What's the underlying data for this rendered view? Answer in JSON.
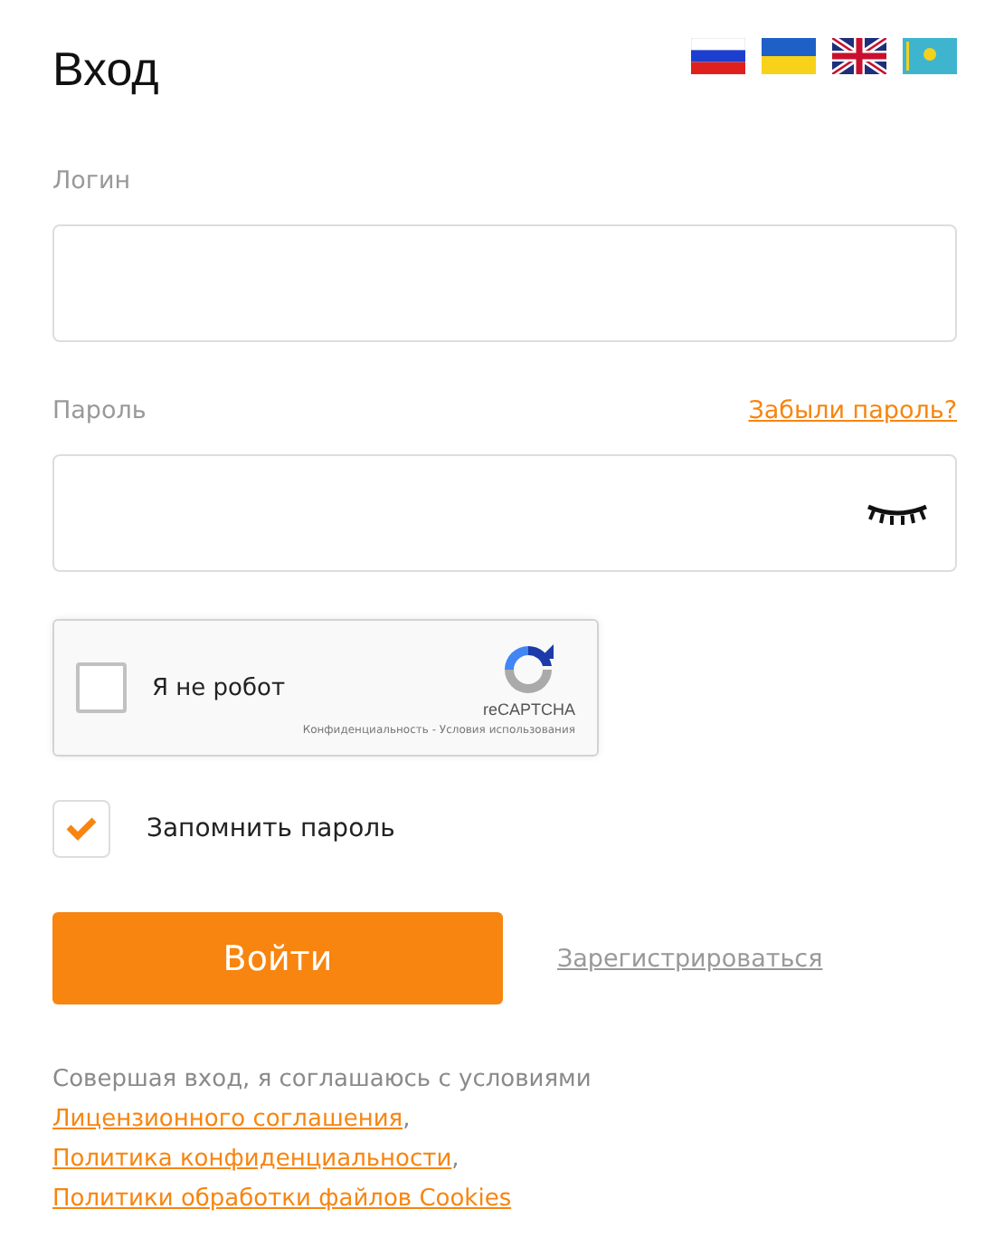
{
  "title": "Вход",
  "login": {
    "label": "Логин"
  },
  "password": {
    "label": "Пароль",
    "forgot_link": "Забыли пароль?"
  },
  "captcha": {
    "label": "Я не робот",
    "checked": false,
    "brand": "reCAPTCHA",
    "footer": "Конфиденциальность - Условия использования"
  },
  "remember": {
    "label": "Запомнить пароль",
    "checked": true
  },
  "submit": "Войти",
  "register_link": "Зарегистрироваться",
  "agreement": {
    "text": "Совершая вход, я соглашаюсь с условиями",
    "links": [
      {
        "text": "Лицензионного соглашения",
        "suffix": ","
      },
      {
        "text": "Политика конфиденциальности",
        "suffix": ","
      },
      {
        "text": "Политики обработки файлов Cookies"
      }
    ]
  }
}
